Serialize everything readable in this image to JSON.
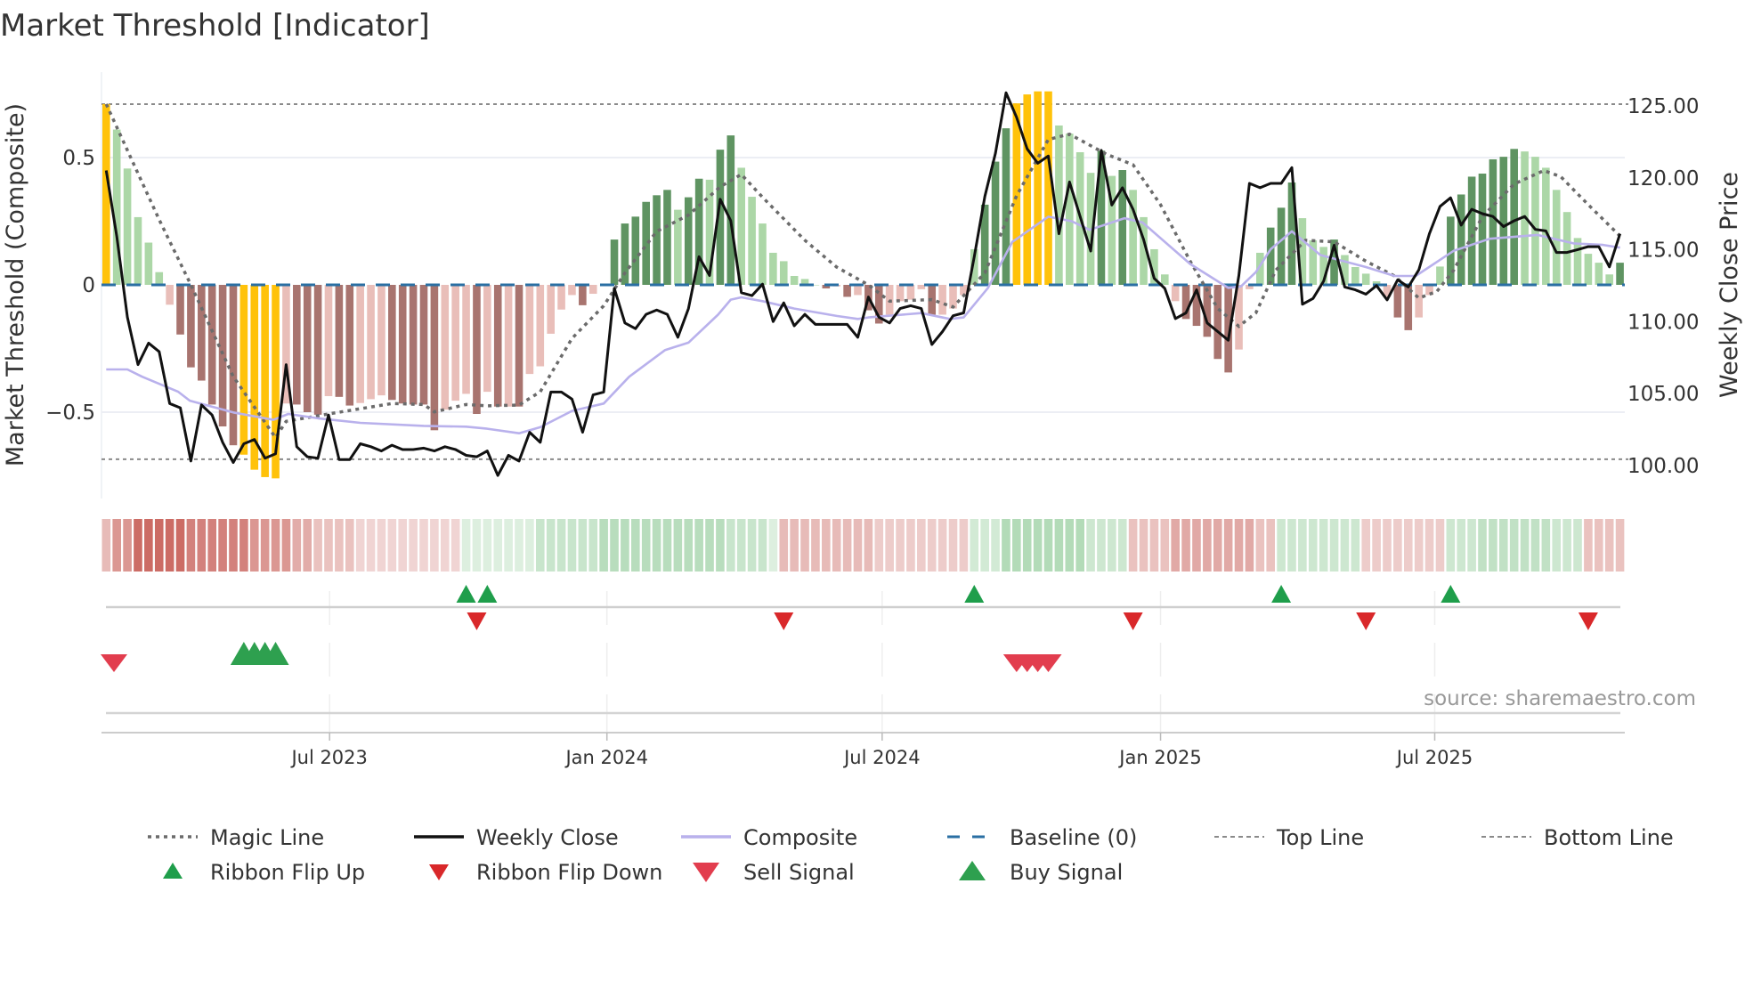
{
  "title": "Market Threshold [Indicator]",
  "source": "source: sharemaestro.com",
  "colors": {
    "yellow": "#FFC20A",
    "dark_green": "#5f9462",
    "light_green": "#acd7a7",
    "dark_red": "#a8746f",
    "light_red": "#e9beb9",
    "close": "#111111",
    "magic": "#6b6b6b",
    "composite": "#b9b1ec",
    "baseline": "#2a6fa3",
    "limit_lines": "#8a8a8a",
    "ribbon_red": "#c4564f",
    "ribbon_green": "#84c48c",
    "flip_up": "#1f9e4b",
    "flip_down": "#d9282a",
    "sell": "#e23d4e",
    "buy": "#2ea04f"
  },
  "legend": [
    {
      "label": "Magic Line",
      "kind": "dotted"
    },
    {
      "label": "Weekly Close",
      "kind": "solid"
    },
    {
      "label": "Composite",
      "kind": "lavender"
    },
    {
      "label": "Baseline (0)",
      "kind": "dashed-blue"
    },
    {
      "label": "Top Line",
      "kind": "dashed-gray"
    },
    {
      "label": "Bottom Line",
      "kind": "dashed-gray"
    },
    {
      "label": "Ribbon Flip Up",
      "kind": "flip-up"
    },
    {
      "label": "Ribbon Flip Down",
      "kind": "flip-down"
    },
    {
      "label": "Sell Signal",
      "kind": "sell"
    },
    {
      "label": "Buy Signal",
      "kind": "buy"
    }
  ],
  "chart_data": {
    "type": "bar+line",
    "title": "Market Threshold [Indicator]",
    "ylabel_left": "Market Threshold (Composite)",
    "ylabel_right": "Weekly Close Price",
    "ylim_left": [
      -0.85,
      0.85
    ],
    "ylim_right": [
      98,
      128
    ],
    "y_left_ticks": [
      {
        "value": 0.5,
        "label": "0.5"
      },
      {
        "value": 0,
        "label": "0"
      },
      {
        "value": -0.5,
        "label": "−0.5"
      }
    ],
    "y_right_ticks": [
      {
        "value": 125,
        "label": "125.00"
      },
      {
        "value": 120,
        "label": "120.00"
      },
      {
        "value": 115,
        "label": "115.00"
      },
      {
        "value": 110,
        "label": "110.00"
      },
      {
        "value": 105,
        "label": "105.00"
      },
      {
        "value": 100,
        "label": "100.00"
      }
    ],
    "x_ticks": [
      {
        "week": 21.1,
        "label": "Jul 2023"
      },
      {
        "week": 47.3,
        "label": "Jan 2024"
      },
      {
        "week": 73.3,
        "label": "Jul 2024"
      },
      {
        "week": 99.6,
        "label": "Jan 2025"
      },
      {
        "week": 125.5,
        "label": "Jul 2025"
      }
    ],
    "top_line": 0.71,
    "bottom_line": -0.685,
    "baseline": 0,
    "composite_bars": [
      0.71,
      0.61,
      0.457,
      0.266,
      0.166,
      0.05,
      -0.078,
      -0.195,
      -0.324,
      -0.376,
      -0.47,
      -0.556,
      -0.63,
      -0.667,
      -0.726,
      -0.755,
      -0.76,
      -0.466,
      -0.47,
      -0.5,
      -0.51,
      -0.437,
      -0.44,
      -0.474,
      -0.464,
      -0.449,
      -0.434,
      -0.452,
      -0.466,
      -0.47,
      -0.47,
      -0.571,
      -0.49,
      -0.455,
      -0.428,
      -0.507,
      -0.42,
      -0.478,
      -0.478,
      -0.478,
      -0.35,
      -0.32,
      -0.192,
      -0.097,
      -0.04,
      -0.08,
      -0.035,
      0,
      0.178,
      0.241,
      0.268,
      0.326,
      0.352,
      0.373,
      0.295,
      0.344,
      0.417,
      0.413,
      0.531,
      0.587,
      0.46,
      0.346,
      0.241,
      0.126,
      0.093,
      0.035,
      0.023,
      0,
      -0.014,
      -0.006,
      -0.047,
      -0.04,
      -0.1,
      -0.152,
      -0.117,
      -0.064,
      -0.058,
      -0.017,
      -0.117,
      -0.117,
      -0.093,
      -0.04,
      0.14,
      0.315,
      0.484,
      0.615,
      0.713,
      0.748,
      0.76,
      0.76,
      0.626,
      0.594,
      0.521,
      0.44,
      0.527,
      0.428,
      0.451,
      0.373,
      0.266,
      0.14,
      0.041,
      -0.064,
      -0.134,
      -0.161,
      -0.204,
      -0.291,
      -0.344,
      -0.254,
      -0.017,
      0.126,
      0.225,
      0.303,
      0.402,
      0.262,
      0.175,
      0.149,
      0.178,
      0.117,
      0.07,
      0.044,
      0.014,
      -0.047,
      -0.128,
      -0.178,
      -0.128,
      -0.04,
      0.072,
      0.268,
      0.355,
      0.425,
      0.437,
      0.493,
      0.503,
      0.534,
      0.524,
      0.503,
      0.46,
      0.373,
      0.286,
      0.184,
      0.122,
      0.087,
      0.041,
      0.087
    ],
    "bar_states": "YgggggrRRRRRRYYYYrRRRrRRrrrRRRRRrrrRrRrRrrrrrRrrGGGGGGgGGgGGggggggggRrRrRRrrrrRrrrgGGGYYYYggggGgGggggrRRRRRrrgGGGgggGggggrRRrrgGGGGGGGgggggggggG",
    "bar_state_legend": {
      "Y": "extreme",
      "G": "strong positive",
      "g": "weak positive",
      "R": "strong negative",
      "r": "weak negative"
    },
    "weekly_close": [
      120.7,
      116.1,
      110.5,
      107.2,
      108.7,
      108.1,
      104.5,
      104.2,
      100.5,
      104.4,
      103.7,
      101.8,
      100.4,
      101.7,
      102.0,
      100.7,
      101.0,
      107.2,
      101.5,
      100.8,
      100.7,
      103.7,
      100.6,
      100.6,
      101.7,
      101.5,
      101.2,
      101.6,
      101.3,
      101.3,
      101.4,
      101.2,
      101.5,
      101.3,
      100.9,
      100.8,
      101.2,
      99.5,
      100.9,
      100.5,
      102.5,
      101.8,
      105.3,
      105.3,
      104.8,
      102.5,
      105.1,
      105.3,
      112.5,
      110.1,
      109.7,
      110.7,
      111.0,
      110.7,
      109.1,
      111.1,
      114.7,
      113.4,
      118.7,
      117.2,
      112.2,
      112.0,
      112.8,
      110.2,
      111.5,
      109.9,
      110.7,
      110.0,
      110.0,
      110.0,
      110.0,
      109.1,
      111.9,
      110.5,
      110.1,
      111.1,
      111.3,
      111.1,
      108.6,
      109.5,
      110.6,
      110.8,
      114.7,
      118.9,
      121.9,
      126.1,
      124.4,
      122.2,
      121.2,
      121.7,
      116.3,
      119.9,
      117.5,
      115.1,
      122.1,
      118.3,
      119.5,
      118.0,
      115.9,
      113.2,
      112.5,
      110.4,
      110.8,
      112.4,
      110.1,
      109.5,
      108.9,
      113.4,
      119.8,
      119.5,
      119.8,
      119.8,
      120.9,
      111.4,
      111.8,
      113.0,
      115.5,
      112.6,
      112.4,
      112.1,
      112.7,
      111.7,
      113.1,
      112.6,
      113.8,
      116.3,
      118.2,
      118.8,
      116.9,
      118.0,
      117.7,
      117.5,
      116.8,
      117.2,
      117.5,
      116.6,
      116.5,
      115.0,
      115.0,
      115.2,
      115.4,
      115.4,
      114.0,
      116.3
    ],
    "magic_line": [
      [
        0,
        0.71
      ],
      [
        5,
        0.256
      ],
      [
        8,
        0
      ],
      [
        12,
        -0.36
      ],
      [
        16,
        -0.6
      ],
      [
        17,
        -0.536
      ],
      [
        21,
        -0.507
      ],
      [
        27,
        -0.466
      ],
      [
        30,
        -0.47
      ],
      [
        31,
        -0.499
      ],
      [
        34,
        -0.47
      ],
      [
        36,
        -0.475
      ],
      [
        39,
        -0.472
      ],
      [
        41,
        -0.42
      ],
      [
        44,
        -0.21
      ],
      [
        47,
        -0.082
      ],
      [
        49,
        0.047
      ],
      [
        52,
        0.21
      ],
      [
        55,
        0.274
      ],
      [
        58,
        0.385
      ],
      [
        60,
        0.434
      ],
      [
        62,
        0.344
      ],
      [
        66,
        0.175
      ],
      [
        69,
        0.07
      ],
      [
        72,
        0
      ],
      [
        74,
        -0.064
      ],
      [
        78,
        -0.058
      ],
      [
        80,
        -0.087
      ],
      [
        83,
        0.047
      ],
      [
        86,
        0.35
      ],
      [
        89,
        0.571
      ],
      [
        91,
        0.592
      ],
      [
        94.5,
        0.513
      ],
      [
        97,
        0.472
      ],
      [
        99.6,
        0.315
      ],
      [
        102.4,
        0.093
      ],
      [
        105,
        -0.093
      ],
      [
        107,
        -0.163
      ],
      [
        108.6,
        -0.11
      ],
      [
        110.5,
        0.058
      ],
      [
        113.3,
        0.175
      ],
      [
        116,
        0.169
      ],
      [
        119,
        0.093
      ],
      [
        121.7,
        0.035
      ],
      [
        124,
        -0.052
      ],
      [
        125.7,
        -0.026
      ],
      [
        127.3,
        0.058
      ],
      [
        130,
        0.268
      ],
      [
        133,
        0.396
      ],
      [
        135.8,
        0.449
      ],
      [
        137.4,
        0.425
      ],
      [
        140,
        0.315
      ],
      [
        143,
        0.192
      ]
    ],
    "composite_line": [
      [
        0,
        -0.332
      ],
      [
        2,
        -0.332
      ],
      [
        3.4,
        -0.361
      ],
      [
        6.8,
        -0.42
      ],
      [
        7.9,
        -0.455
      ],
      [
        12,
        -0.501
      ],
      [
        15.8,
        -0.53
      ],
      [
        17.2,
        -0.507
      ],
      [
        20,
        -0.524
      ],
      [
        24,
        -0.542
      ],
      [
        30,
        -0.554
      ],
      [
        34,
        -0.557
      ],
      [
        36,
        -0.565
      ],
      [
        39,
        -0.583
      ],
      [
        41,
        -0.559
      ],
      [
        44,
        -0.495
      ],
      [
        47,
        -0.466
      ],
      [
        49.4,
        -0.361
      ],
      [
        52.8,
        -0.256
      ],
      [
        55,
        -0.227
      ],
      [
        57.8,
        -0.117
      ],
      [
        59,
        -0.058
      ],
      [
        60,
        -0.049
      ],
      [
        62,
        -0.064
      ],
      [
        65,
        -0.093
      ],
      [
        69,
        -0.122
      ],
      [
        71,
        -0.134
      ],
      [
        72,
        -0.128
      ],
      [
        77,
        -0.111
      ],
      [
        79.7,
        -0.134
      ],
      [
        81,
        -0.128
      ],
      [
        83.3,
        -0.012
      ],
      [
        85.6,
        0.169
      ],
      [
        89,
        0.268
      ],
      [
        91.2,
        0.25
      ],
      [
        92.9,
        0.216
      ],
      [
        96.2,
        0.262
      ],
      [
        97.9,
        0.245
      ],
      [
        102.4,
        0.082
      ],
      [
        106,
        -0.012
      ],
      [
        107.2,
        -0.006
      ],
      [
        108.6,
        0.05
      ],
      [
        110,
        0.14
      ],
      [
        112,
        0.21
      ],
      [
        114.7,
        0.117
      ],
      [
        119,
        0.07
      ],
      [
        121.7,
        0.035
      ],
      [
        123.7,
        0.035
      ],
      [
        127.3,
        0.134
      ],
      [
        130.7,
        0.181
      ],
      [
        135.2,
        0.196
      ],
      [
        138.6,
        0.163
      ],
      [
        141.4,
        0.157
      ],
      [
        143,
        0.146
      ]
    ],
    "ribbon_segments": [
      [
        0,
        0,
        -0.3
      ],
      [
        1,
        2,
        -0.55
      ],
      [
        3,
        7,
        -0.85
      ],
      [
        8,
        13,
        -0.7
      ],
      [
        14,
        17,
        -0.55
      ],
      [
        18,
        19,
        -0.4
      ],
      [
        20,
        23,
        -0.25
      ],
      [
        24,
        33,
        -0.12
      ],
      [
        34,
        40,
        0.15
      ],
      [
        41,
        46,
        0.35
      ],
      [
        47,
        58,
        0.5
      ],
      [
        59,
        62,
        0.35
      ],
      [
        63,
        63,
        0.15
      ],
      [
        64,
        72,
        -0.3
      ],
      [
        73,
        81,
        -0.18
      ],
      [
        82,
        84,
        0.25
      ],
      [
        85,
        92,
        0.55
      ],
      [
        93,
        96,
        0.3
      ],
      [
        97,
        100,
        -0.25
      ],
      [
        101,
        108,
        -0.42
      ],
      [
        109,
        110,
        -0.25
      ],
      [
        111,
        118,
        0.3
      ],
      [
        119,
        126,
        -0.18
      ],
      [
        127,
        129,
        0.3
      ],
      [
        130,
        136,
        0.42
      ],
      [
        137,
        139,
        0.3
      ],
      [
        140,
        143,
        -0.25
      ]
    ],
    "ribbon_flip_up_weeks": [
      34,
      36,
      82,
      111,
      127
    ],
    "ribbon_flip_down_weeks": [
      35,
      64,
      97,
      119,
      140
    ],
    "sell_signal_weeks": [
      0,
      86,
      87,
      88,
      89
    ],
    "buy_signal_weeks": [
      13,
      14,
      15,
      16
    ],
    "legend_position": "bottom"
  }
}
